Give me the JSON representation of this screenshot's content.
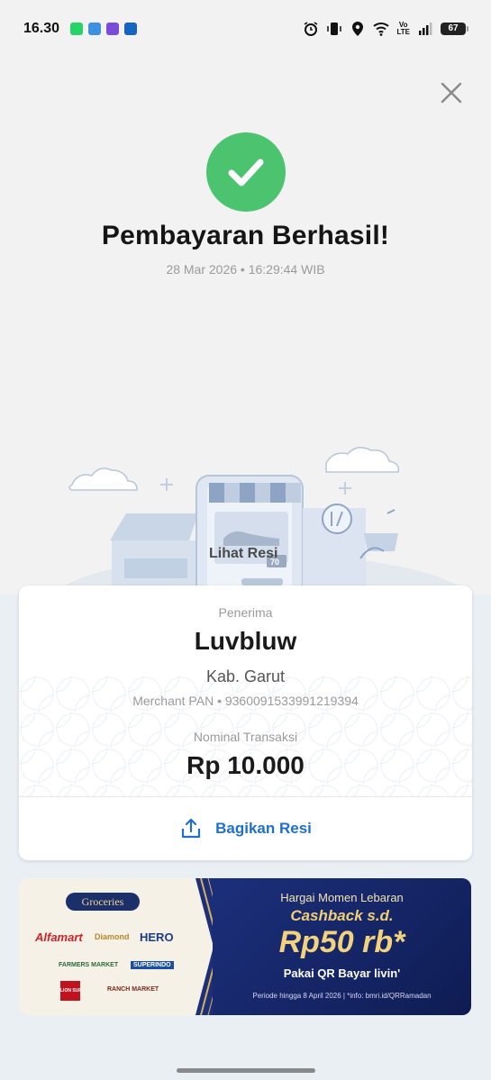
{
  "status_bar": {
    "time": "16.30",
    "battery": "67",
    "network": "Vo\nLTE"
  },
  "header": {
    "title": "Pembayaran Berhasil!",
    "datetime": "28 Mar 2026 • 16:29:44 WIB"
  },
  "illustration": {
    "receipt_label": "Lihat Resi",
    "price_tag": "70"
  },
  "receipt": {
    "receiver_label": "Penerima",
    "receiver_name": "Luvbluw",
    "receiver_city": "Kab. Garut",
    "merchant_pan": "Merchant PAN • 9360091533991219394",
    "amount_label": "Nominal Transaksi",
    "amount": "Rp 10.000",
    "share_label": "Bagikan Resi"
  },
  "promo_banner": {
    "category_tag": "Groceries",
    "logos": [
      "Alfamart",
      "Diamond",
      "HERO",
      "FARMERS MARKET",
      "SUPERINDO",
      "LION SUPER INDO",
      "RANCH MARKET"
    ],
    "headline": "Hargai Momen Lebaran",
    "cashback_label": "Cashback s.d.",
    "cashback_amount": "Rp50 rb*",
    "payment_label": "Pakai QR Bayar livin'",
    "period": "Periode hingga 8 April 2026  |  *info: bmri.id/QRRamadan"
  },
  "colors": {
    "success_green": "#4cc46f",
    "link_blue": "#1f6fd1",
    "banner_navy": "#1c2f7a",
    "banner_gold": "#f0cf75"
  }
}
